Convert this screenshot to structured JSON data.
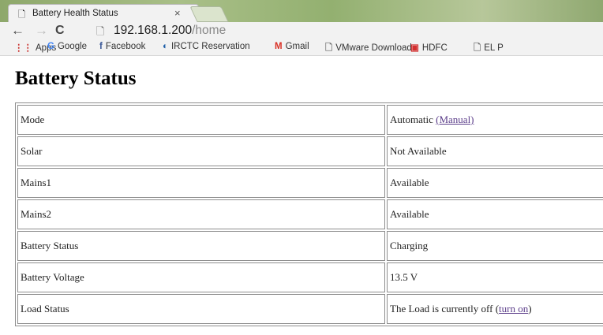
{
  "browser": {
    "tab": {
      "title": "Battery Health Status",
      "close_icon": "×",
      "doc_icon": "page-icon"
    },
    "toolbar": {
      "back_icon": "←",
      "forward_icon": "→",
      "reload_icon": "C",
      "url_host": "192.168.1.200",
      "url_path": "/home"
    },
    "bookmarks": [
      {
        "label": "Apps",
        "icon": "apps-grid-icon",
        "glyph": "⋮⋮",
        "color": "#c9302c"
      },
      {
        "label": "Google",
        "icon": "google-icon",
        "glyph": "G",
        "color": "#4285f4"
      },
      {
        "label": "Facebook",
        "icon": "facebook-icon",
        "glyph": "f",
        "color": "#3b5998"
      },
      {
        "label": "IRCTC Reservation",
        "icon": "irctc-icon",
        "glyph": "◐",
        "color": "#1f5fa8"
      },
      {
        "label": "Gmail",
        "icon": "gmail-icon",
        "glyph": "M",
        "color": "#d93025"
      },
      {
        "label": "VMware Download",
        "icon": "page-icon",
        "glyph": "🗋",
        "color": "#777777"
      },
      {
        "label": "HDFC",
        "icon": "hdfc-icon",
        "glyph": "▣",
        "color": "#d32f2f"
      },
      {
        "label": "EL P",
        "icon": "page-icon",
        "glyph": "🗋",
        "color": "#777777"
      }
    ]
  },
  "page": {
    "title": "Battery Status",
    "rows": [
      {
        "label": "Mode",
        "value": "Automatic ",
        "link": "(Manual)",
        "suffix": ""
      },
      {
        "label": "Solar",
        "value": "Not Available",
        "link": "",
        "suffix": ""
      },
      {
        "label": "Mains1",
        "value": "Available",
        "link": "",
        "suffix": ""
      },
      {
        "label": "Mains2",
        "value": "Available",
        "link": "",
        "suffix": ""
      },
      {
        "label": "Battery Status",
        "value": "Charging",
        "link": "",
        "suffix": ""
      },
      {
        "label": "Battery Voltage",
        "value": "13.5 V",
        "link": "",
        "suffix": ""
      },
      {
        "label": "Load Status",
        "value": "The Load is currently off (",
        "link": "turn on",
        "suffix": ")"
      }
    ]
  }
}
